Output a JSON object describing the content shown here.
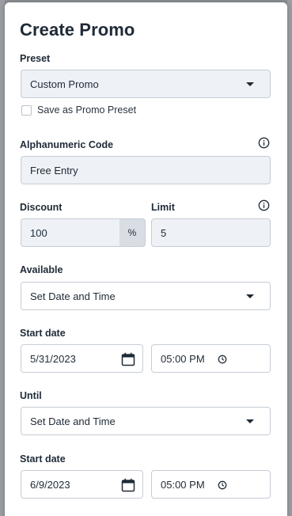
{
  "modal": {
    "title": "Create Promo"
  },
  "preset": {
    "label": "Preset",
    "value": "Custom Promo",
    "save_checkbox_label": "Save as Promo Preset",
    "save_checked": false
  },
  "code": {
    "label": "Alphanumeric Code",
    "value": "Free Entry"
  },
  "discount": {
    "label": "Discount",
    "value": "100",
    "unit": "%"
  },
  "limit": {
    "label": "Limit",
    "value": "5"
  },
  "available": {
    "label": "Available",
    "value": "Set Date and Time"
  },
  "start1": {
    "label": "Start date",
    "date": "5/31/2023",
    "time": "05:00 PM"
  },
  "until": {
    "label": "Until",
    "value": "Set Date and Time"
  },
  "start2": {
    "label": "Start date",
    "date": "6/9/2023",
    "time": "05:00 PM"
  },
  "icons": {
    "info": "info-icon",
    "calendar": "calendar-icon",
    "clock": "clock-icon",
    "dropdown": "chevron-down-icon"
  }
}
